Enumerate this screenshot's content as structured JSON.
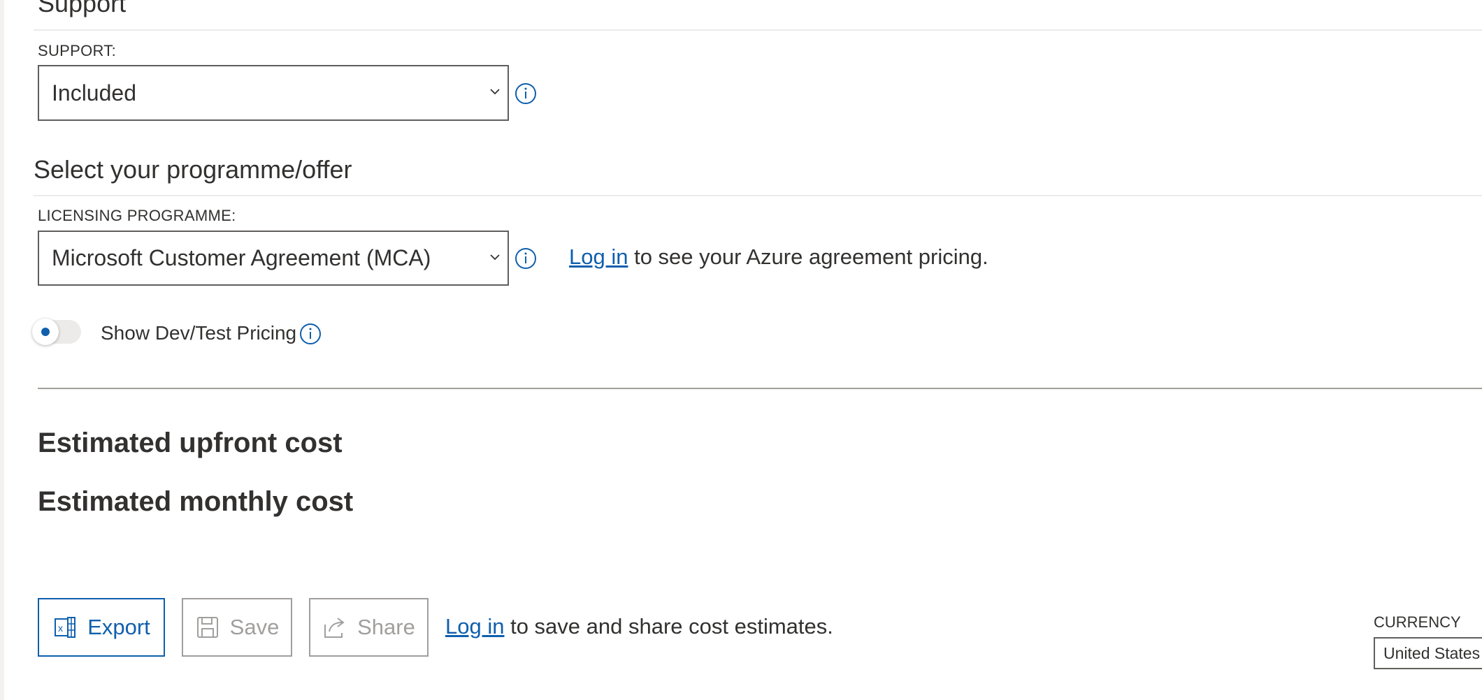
{
  "support_section": {
    "heading": "Support",
    "field_label": "SUPPORT:",
    "selected": "Included"
  },
  "programme_section": {
    "heading": "Select your programme/offer",
    "field_label": "LICENSING PROGRAMME:",
    "selected": "Microsoft Customer Agreement (MCA)",
    "login_link": "Log in",
    "login_suffix": "to see your Azure agreement pricing.",
    "devtest_toggle": {
      "label": "Show Dev/Test Pricing",
      "on": false
    }
  },
  "estimates": {
    "upfront_heading": "Estimated upfront cost",
    "monthly_heading": "Estimated monthly cost"
  },
  "actions": {
    "export_label": "Export",
    "save_label": "Save",
    "share_label": "Share",
    "login_link": "Log in",
    "login_suffix": "to save and share cost estimates."
  },
  "currency": {
    "label": "CURRENCY",
    "selected": "United States"
  },
  "colors": {
    "accent": "#0f5fad",
    "text": "#323130",
    "disabled": "#a19f9d"
  },
  "icons": {
    "info": "info-icon",
    "dropdown": "chevron-down-icon",
    "export": "excel-icon",
    "save": "floppy-disk-icon",
    "share": "share-icon"
  }
}
